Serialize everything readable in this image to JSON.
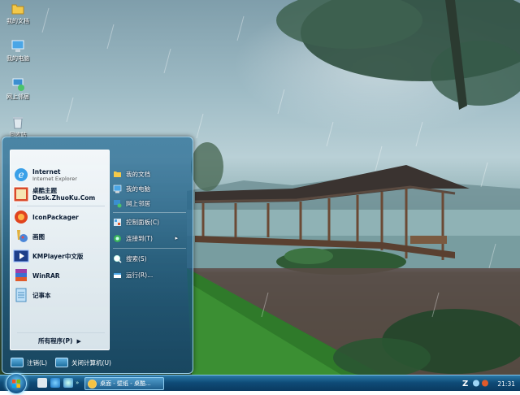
{
  "desktop_icons": [
    {
      "label": "我的文档",
      "icon": "folder-icon"
    },
    {
      "label": "我的电脑",
      "icon": "computer-icon"
    },
    {
      "label": "网上邻居",
      "icon": "network-icon"
    },
    {
      "label": "回收站",
      "icon": "recycle-bin-icon"
    }
  ],
  "start_menu": {
    "programs": [
      {
        "name": "Internet",
        "sub": "Internet Explorer",
        "icon": "internet-explorer-icon"
      },
      {
        "name": "桌酷主题",
        "sub": "Desk.ZhuoKu.Com",
        "icon": "zhuoku-icon"
      },
      {
        "name": "IconPackager",
        "sub": "",
        "icon": "iconpackager-icon"
      },
      {
        "name": "画图",
        "sub": "",
        "icon": "paint-icon"
      },
      {
        "name": "KMPlayer中文版",
        "sub": "",
        "icon": "kmplayer-icon"
      },
      {
        "name": "WinRAR",
        "sub": "",
        "icon": "winrar-icon"
      },
      {
        "name": "记事本",
        "sub": "",
        "icon": "notepad-icon"
      }
    ],
    "all_programs": "所有程序(P)",
    "all_programs_arrow": "▶",
    "places": [
      {
        "label": "我的文档",
        "icon": "folder-icon"
      },
      {
        "label": "我的电脑",
        "icon": "computer-icon"
      },
      {
        "label": "网上邻居",
        "icon": "network-icon"
      },
      {
        "label": "控制面板(C)",
        "icon": "control-panel-icon"
      },
      {
        "label": "连接到(T)",
        "icon": "connect-icon",
        "arrow": "▸"
      },
      {
        "label": "搜索(S)",
        "icon": "search-icon"
      },
      {
        "label": "运行(R)...",
        "icon": "run-icon"
      }
    ],
    "logoff": "注销(L)",
    "shutdown": "关闭计算机(U)"
  },
  "taskbar": {
    "task_label": "桌面 - 壁纸 - 桌酷...",
    "tray_letter": "Z",
    "clock": "21:31"
  },
  "colors": {
    "taskbar": "#0f4c78",
    "menu_frame": "#1e6a97",
    "menu_panel": "#f2f7fa"
  }
}
